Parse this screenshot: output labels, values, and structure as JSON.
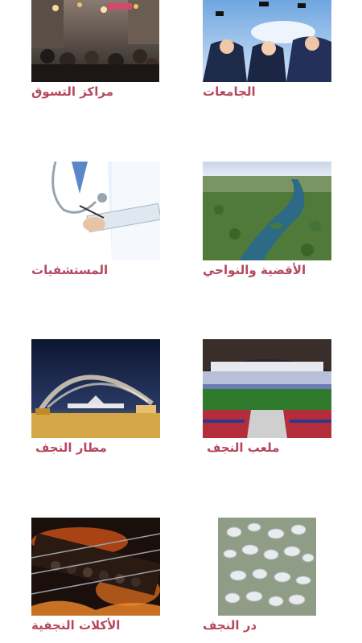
{
  "colors": {
    "caption": "#b5485f",
    "background": "#ffffff"
  },
  "tiles": [
    {
      "id": "shopping",
      "label": "مراكز التسوق",
      "image": "shopping-mall-crowd-image"
    },
    {
      "id": "universities",
      "label": "الجامعات",
      "image": "graduates-throwing-caps-image"
    },
    {
      "id": "hospitals",
      "label": "المستشفيات",
      "image": "doctor-with-clipboard-image"
    },
    {
      "id": "districts",
      "label": "الأقضية والنواحي",
      "image": "river-aerial-image"
    },
    {
      "id": "airport",
      "label": "مطار النجف",
      "image": "airplane-water-salute-image"
    },
    {
      "id": "stadium",
      "label": "ملعب النجف",
      "image": "football-stadium-image"
    },
    {
      "id": "food",
      "label": "الأكلات النجفية",
      "image": "grilled-kebab-image"
    },
    {
      "id": "gems",
      "label": "در النجف",
      "image": "najaf-pearl-stones-image"
    }
  ]
}
